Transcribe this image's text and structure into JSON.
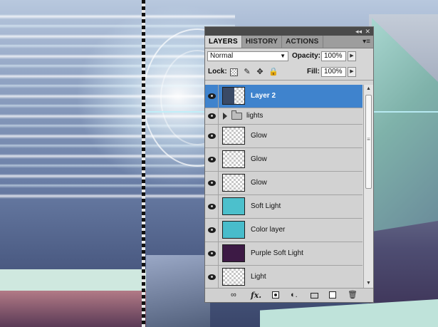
{
  "panel": {
    "tabs": [
      {
        "label": "LAYERS",
        "active": true
      },
      {
        "label": "HISTORY",
        "active": false
      },
      {
        "label": "ACTIONS",
        "active": false
      }
    ],
    "collapse_icon": "double-chevron-icon",
    "close_icon": "close-icon",
    "menu_icon": "panel-menu-icon",
    "blend_mode": "Normal",
    "opacity_label": "Opacity:",
    "opacity_value": "100%",
    "lock_label": "Lock:",
    "fill_label": "Fill:",
    "fill_value": "100%",
    "layers": [
      {
        "name": "Layer 2",
        "kind": "layer2",
        "selected": true
      },
      {
        "name": "lights",
        "kind": "group",
        "selected": false
      },
      {
        "name": "Glow",
        "kind": "checker",
        "selected": false
      },
      {
        "name": "Glow",
        "kind": "checker",
        "selected": false
      },
      {
        "name": "Glow",
        "kind": "checker",
        "selected": false
      },
      {
        "name": "Soft Light",
        "kind": "solid",
        "color": "#4cc0cc",
        "selected": false
      },
      {
        "name": "Color layer",
        "kind": "solid",
        "color": "#48bccb",
        "selected": false
      },
      {
        "name": "Purple Soft Light",
        "kind": "solid",
        "color": "#3d1a45",
        "selected": false
      },
      {
        "name": "Light",
        "kind": "checker",
        "selected": false
      }
    ]
  },
  "colors": {
    "selection": "#3f83cd",
    "panel_bg": "#d6d6d6"
  }
}
